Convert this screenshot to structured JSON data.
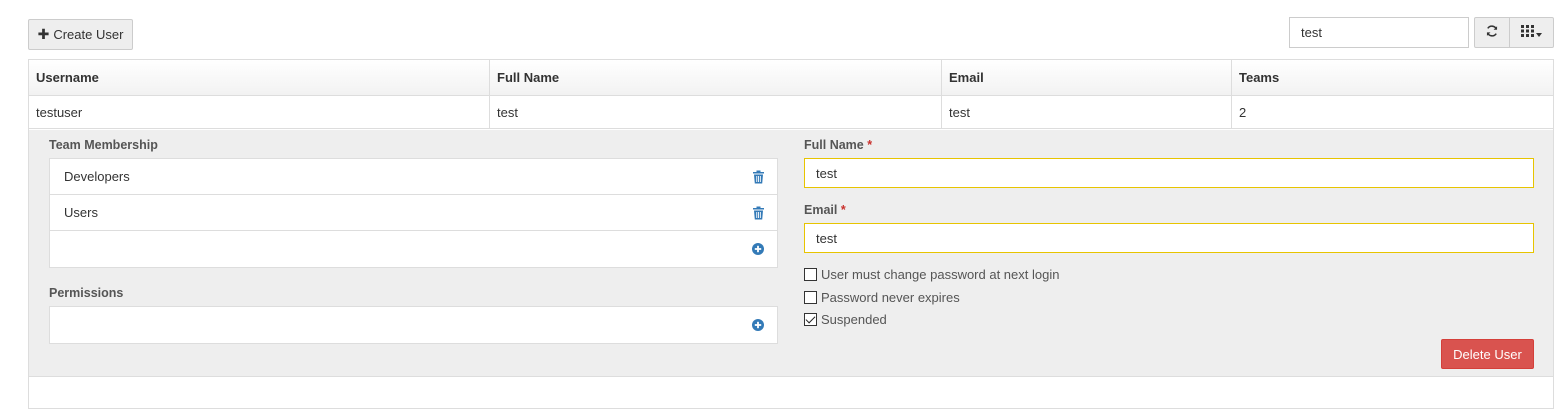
{
  "toolbar": {
    "create_user_label": "Create User",
    "search_value": "test",
    "refresh_icon": "refresh-icon",
    "columns_icon": "columns-grid-icon"
  },
  "table": {
    "columns": [
      "Username",
      "Full Name",
      "Email",
      "Teams"
    ],
    "rows": [
      {
        "username": "testuser",
        "full_name": "test",
        "email": "test",
        "teams": "2"
      }
    ]
  },
  "detail": {
    "team_membership_label": "Team Membership",
    "teams": [
      "Developers",
      "Users"
    ],
    "permissions_label": "Permissions",
    "full_name_label": "Full Name",
    "full_name_value": "test",
    "email_label": "Email",
    "email_value": "test",
    "required_marker": "*",
    "checkboxes": [
      {
        "label": "User must change password at next login",
        "checked": false
      },
      {
        "label": "Password never expires",
        "checked": false
      },
      {
        "label": "Suspended",
        "checked": true
      }
    ],
    "delete_label": "Delete User"
  },
  "colors": {
    "danger": "#d9534f",
    "accent_icon": "#337ab7",
    "required": "#c9302c",
    "input_highlight": "#e7c400"
  }
}
